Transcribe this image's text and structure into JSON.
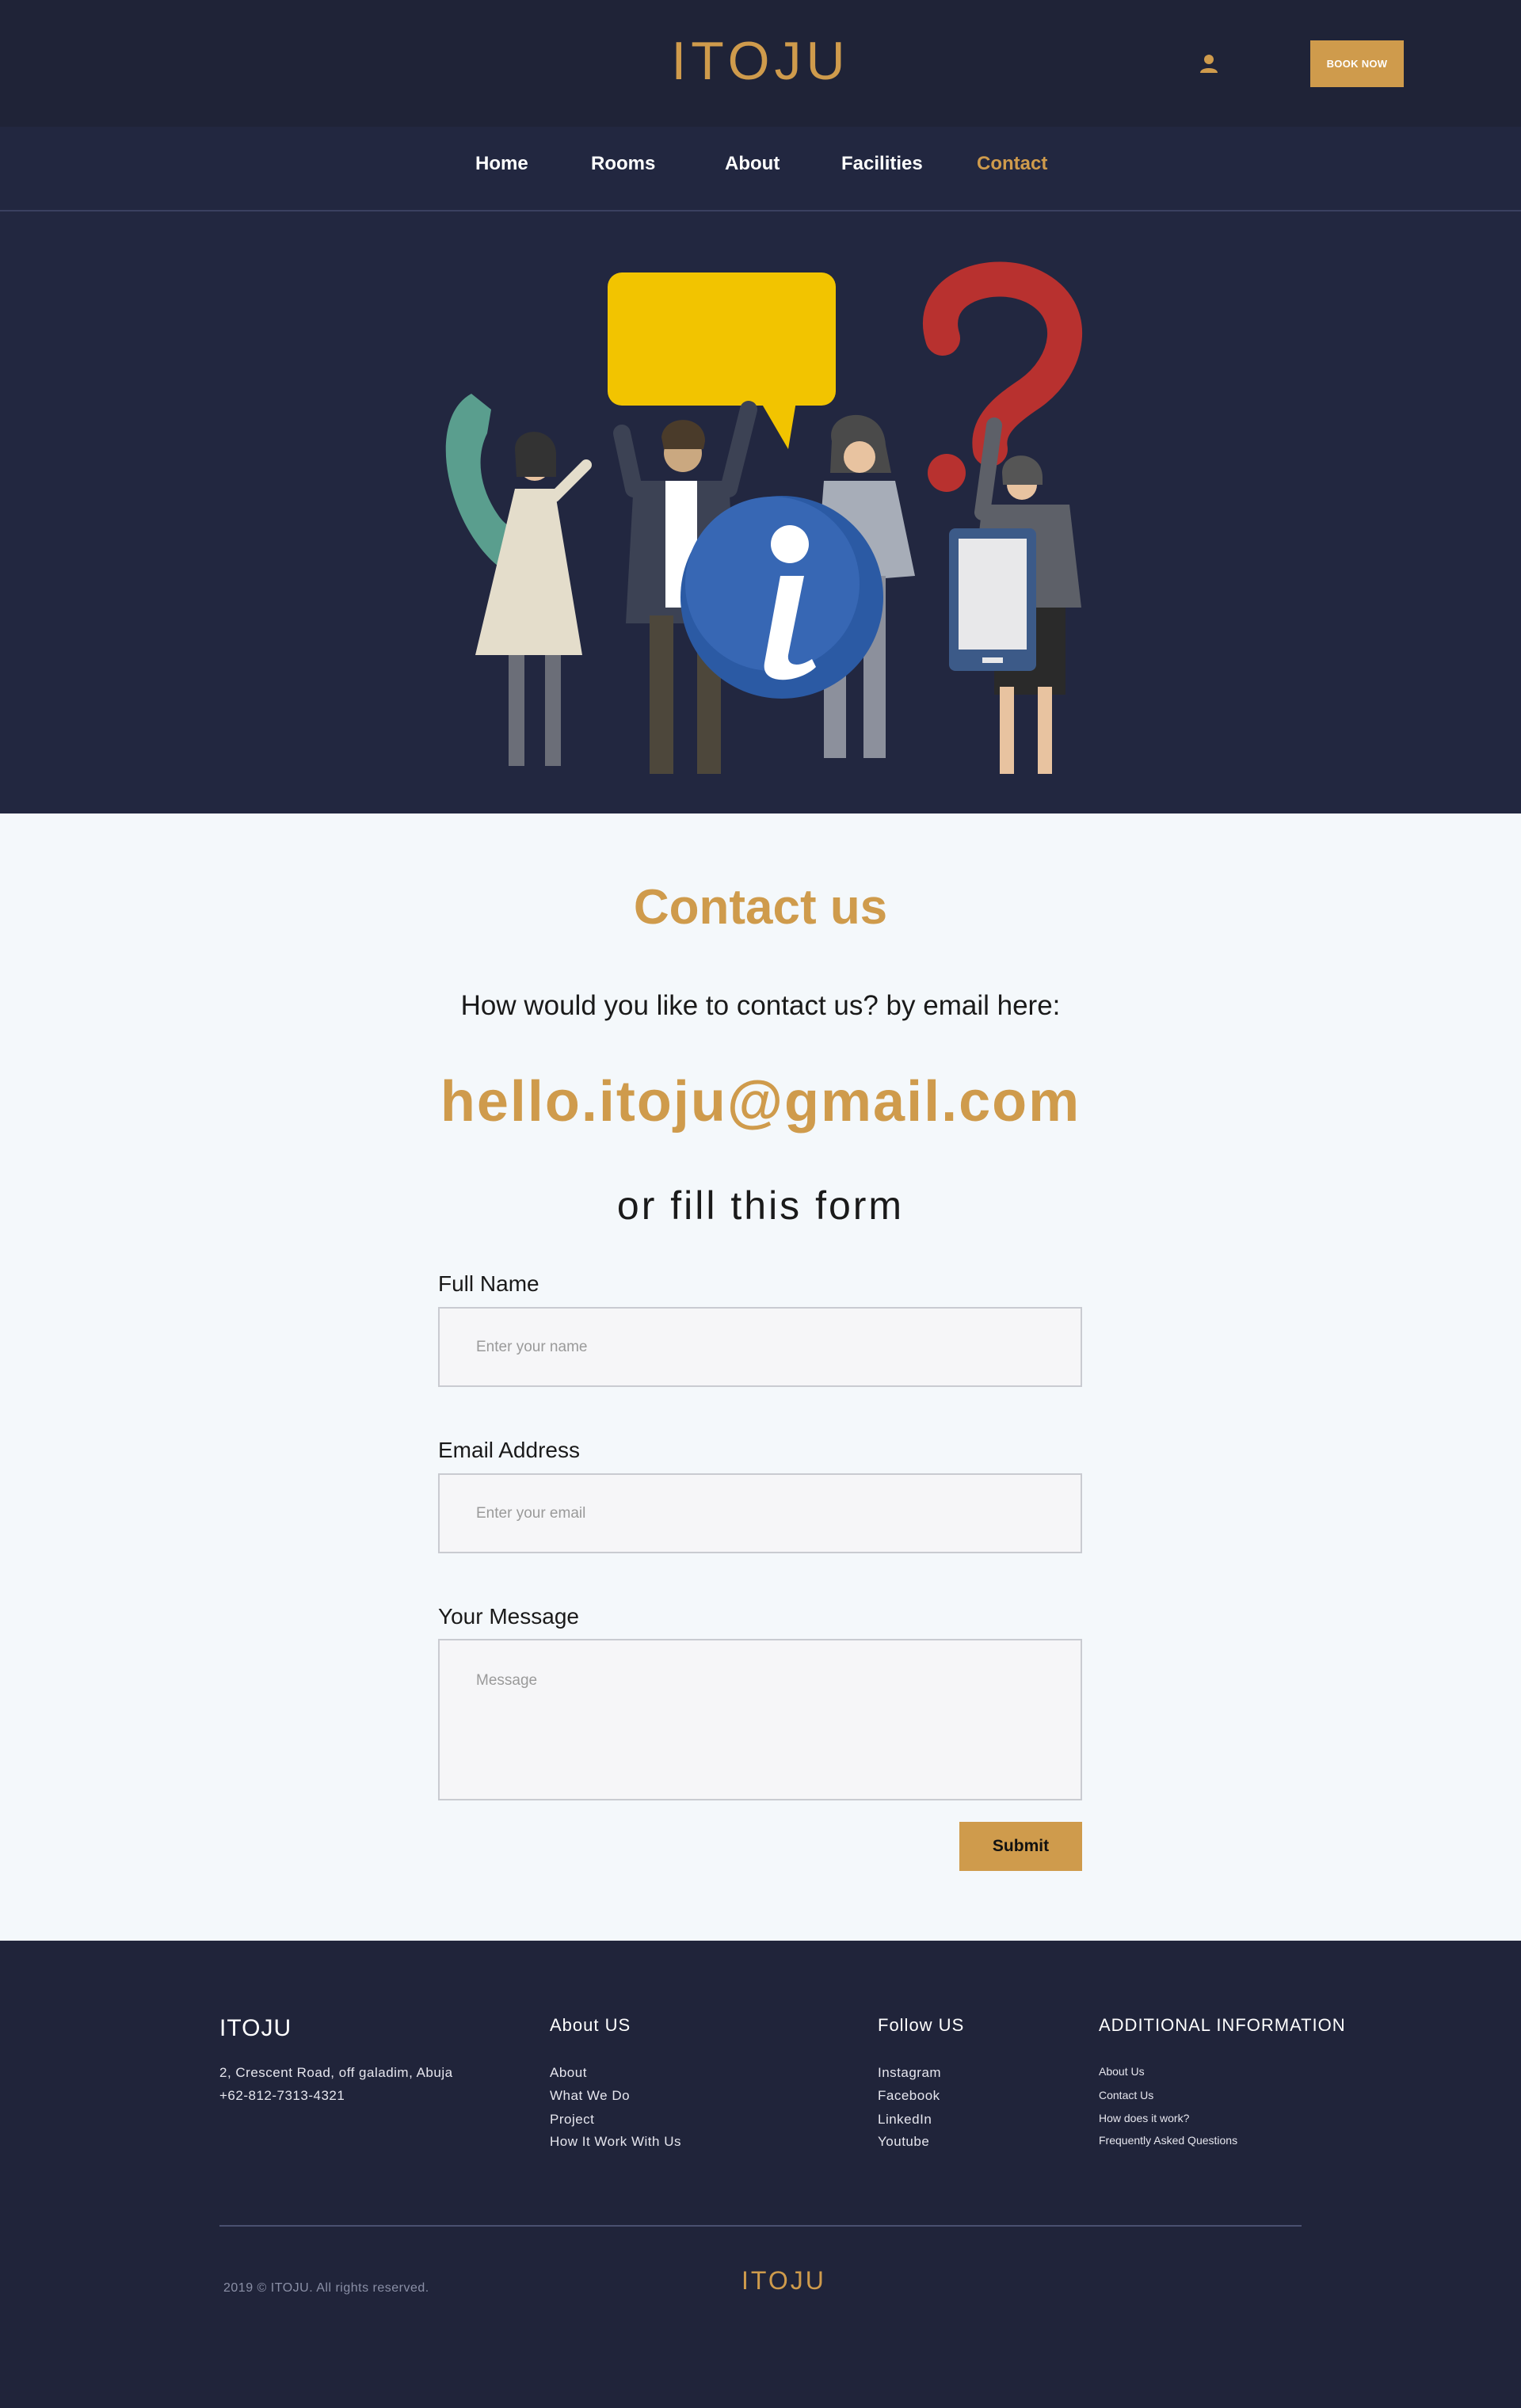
{
  "header": {
    "logo": "ITOJU",
    "user_icon": "user-icon",
    "book_now_label": "BOOK NOW"
  },
  "nav": {
    "items": [
      {
        "label": "Home"
      },
      {
        "label": "Rooms"
      },
      {
        "label": "About"
      },
      {
        "label": "Facilities"
      },
      {
        "label": "Contact",
        "active": true
      }
    ]
  },
  "hero": {
    "illustration": "customer-support-team-illustration",
    "info_glyph": "i"
  },
  "contact": {
    "title": "Contact us",
    "subtitle": "How would you like to contact us? by email here:",
    "email": "hello.itoju@gmail.com",
    "or_text": "or fill this form"
  },
  "form": {
    "full_name": {
      "label": "Full Name",
      "placeholder": "Enter your name",
      "value": ""
    },
    "email": {
      "label": "Email Address",
      "placeholder": "Enter your email",
      "value": ""
    },
    "message": {
      "label": "Your Message",
      "placeholder": "Message",
      "value": ""
    },
    "submit_label": "Submit"
  },
  "footer": {
    "brand": "ITOJU",
    "address": "2, Crescent Road, off galadim, Abuja",
    "phone": "+62-812-7313-4321",
    "about": {
      "heading": "About US",
      "links": [
        "About",
        "What We Do",
        "Project",
        "How It Work With Us"
      ]
    },
    "follow": {
      "heading": "Follow US",
      "links": [
        "Instagram",
        "Facebook",
        "LinkedIn",
        "Youtube"
      ]
    },
    "additional": {
      "heading": "ADDITIONAL INFORMATION",
      "links": [
        "About Us",
        "Contact Us",
        "How does it work?",
        "Frequently Asked Questions"
      ]
    },
    "copyright": "2019 © ITOJU. All rights reserved.",
    "bottom_logo": "ITOJU"
  },
  "colors": {
    "accent": "#cf9b4c",
    "dark_bg": "#1f2337",
    "nav_bg": "#222740",
    "page_bg": "#f4f8fb"
  }
}
